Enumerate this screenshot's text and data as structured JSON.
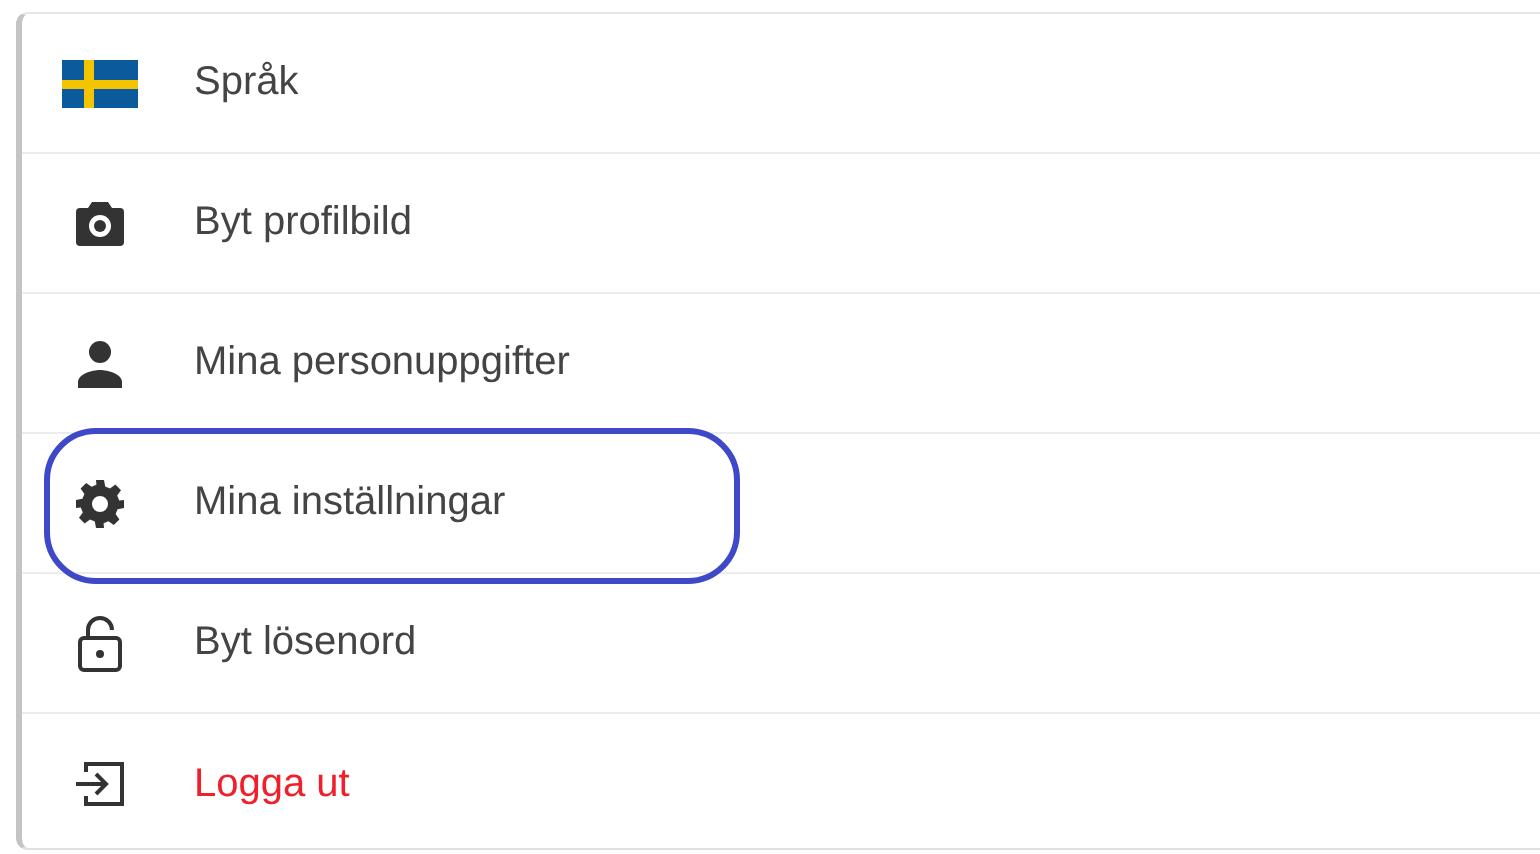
{
  "menu": {
    "items": [
      {
        "kind": "flag",
        "label": "Språk",
        "danger": false,
        "highlighted": false
      },
      {
        "kind": "camera",
        "label": "Byt profilbild",
        "danger": false,
        "highlighted": false
      },
      {
        "kind": "person",
        "label": "Mina personuppgifter",
        "danger": false,
        "highlighted": false
      },
      {
        "kind": "gear",
        "label": "Mina inställningar",
        "danger": false,
        "highlighted": true
      },
      {
        "kind": "lock",
        "label": "Byt lösenord",
        "danger": false,
        "highlighted": false
      },
      {
        "kind": "logout",
        "label": "Logga ut",
        "danger": true,
        "highlighted": false
      }
    ]
  }
}
